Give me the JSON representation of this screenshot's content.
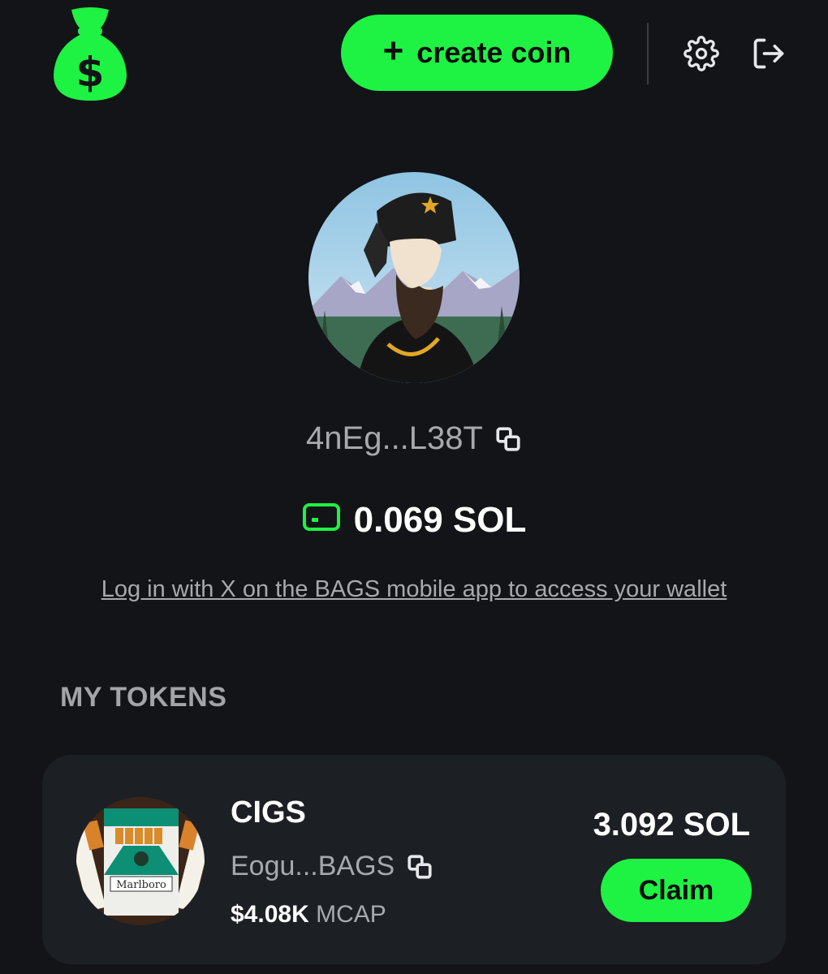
{
  "header": {
    "create_label": "create coin",
    "plus": "+"
  },
  "profile": {
    "address": "4nEg...L38T",
    "balance": "0.069 SOL",
    "login_link": "Log in with X on the BAGS mobile app to access your wallet"
  },
  "section": {
    "title": "MY TOKENS"
  },
  "tokens": [
    {
      "name": "CIGS",
      "address": "Eogu...BAGS",
      "mcap_value": "$4.08K",
      "mcap_label": "MCAP",
      "balance": "3.092 SOL",
      "claim_label": "Claim"
    }
  ],
  "colors": {
    "accent": "#1ef243",
    "background": "#121418",
    "card": "#1c1f24",
    "muted_text": "#a7a9ad"
  },
  "icons": {
    "logo": "money-bag-icon",
    "settings": "gear-icon",
    "logout": "logout-icon",
    "copy": "copy-icon",
    "wallet": "wallet-icon"
  }
}
